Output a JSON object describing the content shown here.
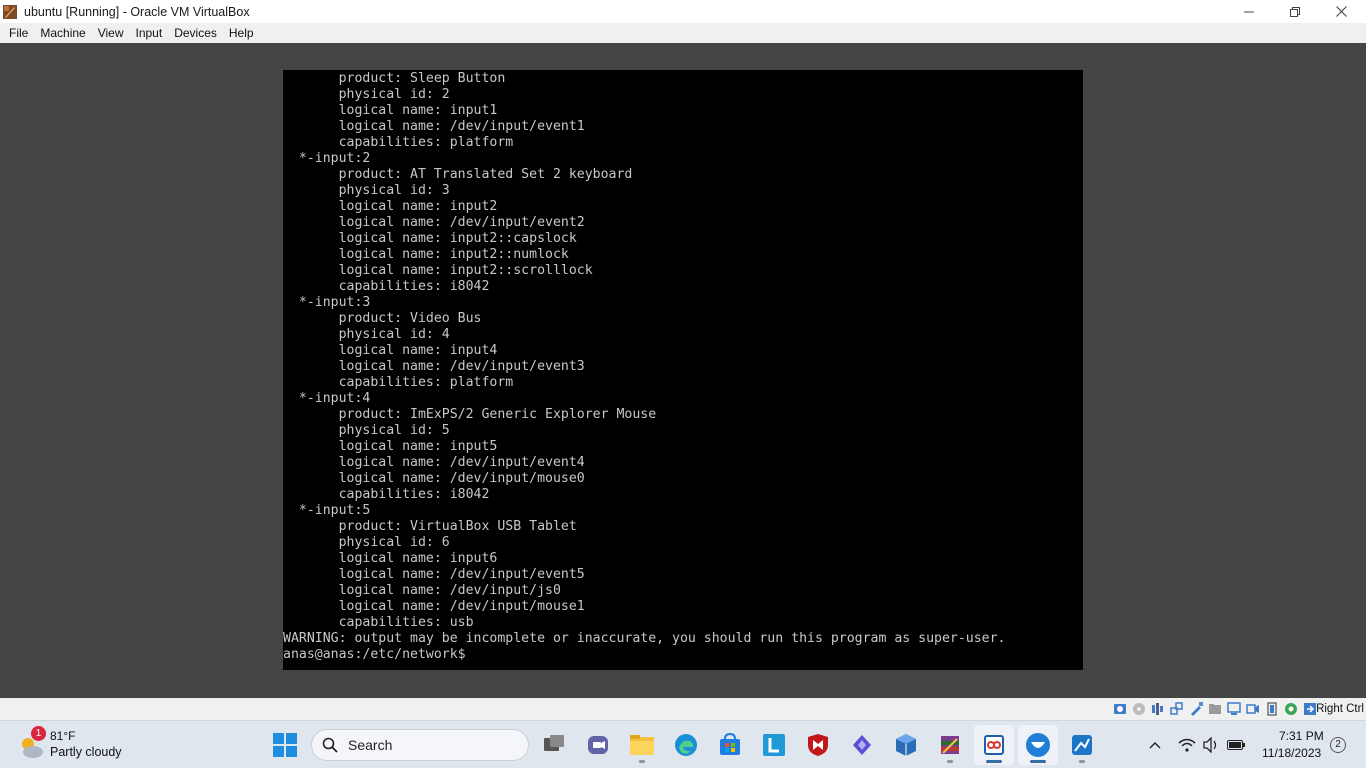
{
  "window": {
    "title": "ubuntu [Running] - Oracle VM VirtualBox",
    "controls": [
      "minimize",
      "restore",
      "close"
    ]
  },
  "menubar": {
    "items": [
      "File",
      "Machine",
      "View",
      "Input",
      "Devices",
      "Help"
    ]
  },
  "console": {
    "lines": [
      "       product: Sleep Button",
      "       physical id: 2",
      "       logical name: input1",
      "       logical name: /dev/input/event1",
      "       capabilities: platform",
      "  *-input:2",
      "       product: AT Translated Set 2 keyboard",
      "       physical id: 3",
      "       logical name: input2",
      "       logical name: /dev/input/event2",
      "       logical name: input2::capslock",
      "       logical name: input2::numlock",
      "       logical name: input2::scrolllock",
      "       capabilities: i8042",
      "  *-input:3",
      "       product: Video Bus",
      "       physical id: 4",
      "       logical name: input4",
      "       logical name: /dev/input/event3",
      "       capabilities: platform",
      "  *-input:4",
      "       product: ImExPS/2 Generic Explorer Mouse",
      "       physical id: 5",
      "       logical name: input5",
      "       logical name: /dev/input/event4",
      "       logical name: /dev/input/mouse0",
      "       capabilities: i8042",
      "  *-input:5",
      "       product: VirtualBox USB Tablet",
      "       physical id: 6",
      "       logical name: input6",
      "       logical name: /dev/input/event5",
      "       logical name: /dev/input/js0",
      "       logical name: /dev/input/mouse1",
      "       capabilities: usb",
      "WARNING: output may be incomplete or inaccurate, you should run this program as super-user.",
      "anas@anas:/etc/network$"
    ]
  },
  "statusbar": {
    "icons": [
      "hard-disk-icon",
      "optical-drive-icon",
      "audio-icon",
      "network-icon",
      "usb-icon",
      "shared-folders-icon",
      "display-icon",
      "recording-icon",
      "cpu-icon",
      "mouse-integration-icon"
    ],
    "host_key": "Right Ctrl"
  },
  "taskbar": {
    "weather": {
      "temp": "81°F",
      "desc": "Partly cloudy",
      "badge": "1"
    },
    "search_label": "Search",
    "apps": [
      "task-view",
      "teams-chat",
      "file-explorer",
      "edge",
      "microsoft-store",
      "l-app",
      "mcafee",
      "vs-app",
      "virtualbox-cube",
      "winrar",
      "snipping-tool",
      "ubuntu-vm",
      "sketch-app"
    ],
    "clock": {
      "time": "7:31 PM",
      "date": "11/18/2023"
    },
    "notifications": "2"
  },
  "colors": {
    "vm_background": "#444444",
    "terminal_bg": "#000000",
    "terminal_fg": "#c8c8c8",
    "taskbar_bg": "#dfe6ee"
  }
}
